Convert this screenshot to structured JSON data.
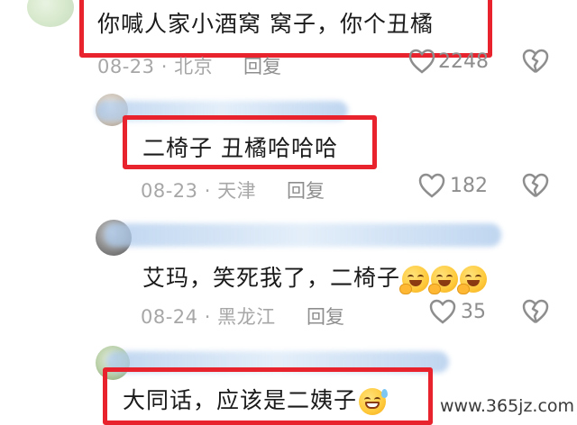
{
  "comments": [
    {
      "text": "你喊人家小酒窝 窝子，你个丑橘",
      "date": "08-23",
      "location": "北京",
      "reply_label": "回复",
      "like_count": "2248"
    },
    {
      "text": "二椅子 丑橘哈哈哈",
      "date": "08-23",
      "location": "天津",
      "reply_label": "回复",
      "like_count": "182"
    },
    {
      "text": "艾玛，笑死我了，二椅子",
      "date": "08-24",
      "location": "黑龙江",
      "reply_label": "回复",
      "like_count": "35",
      "emojis": [
        "grin-covering-mouth",
        "grin-covering-mouth",
        "grin-covering-mouth"
      ]
    },
    {
      "text": "大同话，应该是二姨子",
      "emojis": [
        "grinning-sweat"
      ]
    }
  ],
  "separator": "·",
  "watermark": "www.365jz.com",
  "colors": {
    "highlight_border": "#e8232d",
    "meta_text": "#a7a7a7",
    "icon_gray": "#8e8e8e"
  },
  "icons": [
    "heart-outline-icon",
    "broken-heart-icon"
  ]
}
